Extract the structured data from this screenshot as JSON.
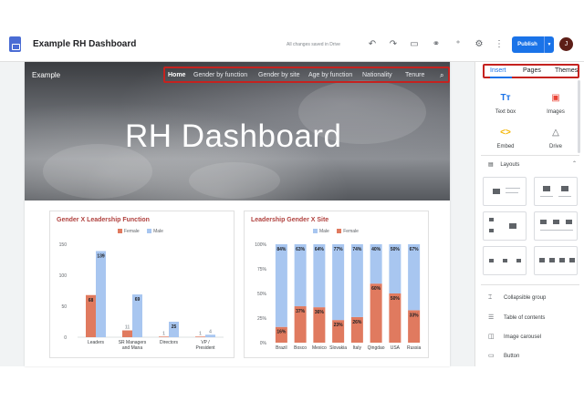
{
  "app": {
    "doc_title": "Example RH Dashboard",
    "save_status": "All changes saved in Drive",
    "publish_label": "Publish",
    "avatar_initial": "J"
  },
  "site": {
    "name": "Example",
    "nav": [
      "Home",
      "Gender by function",
      "Gender by site",
      "Age by function",
      "Nationality",
      "Tenure"
    ],
    "hero_title": "RH Dashboard"
  },
  "chart_data": [
    {
      "type": "bar",
      "title": "Gender X Leadership Function",
      "categories": [
        "Leaders",
        "SR Managers and Mana",
        "Directors",
        "VP / President"
      ],
      "series": [
        {
          "name": "Female",
          "values": [
            68,
            11,
            1,
            1
          ],
          "color": "#e07a5f"
        },
        {
          "name": "Male",
          "values": [
            139,
            69,
            25,
            4
          ],
          "color": "#a8c6f0"
        }
      ],
      "yticks": [
        "0",
        "50",
        "100",
        "150"
      ],
      "ylim": [
        0,
        150
      ],
      "legend": "top"
    },
    {
      "type": "bar",
      "stacked": true,
      "title": "Leadership Gender X Site",
      "categories": [
        "Brazil",
        "Bosco",
        "Mexico",
        "Slovakia",
        "Italy",
        "Qingdao",
        "USA",
        "Russia"
      ],
      "series": [
        {
          "name": "Female",
          "values": [
            16,
            37,
            36,
            23,
            26,
            60,
            50,
            33
          ],
          "labels": [
            "16%",
            "37%",
            "36%",
            "23%",
            "26%",
            "60%",
            "50%",
            "33%"
          ],
          "color": "#e07a5f"
        },
        {
          "name": "Male",
          "values": [
            84,
            63,
            64,
            77,
            74,
            40,
            50,
            67
          ],
          "labels": [
            "84%",
            "63%",
            "64%",
            "77%",
            "74%",
            "40%",
            "50%",
            "67%"
          ],
          "color": "#a8c6f0"
        }
      ],
      "yticks": [
        "0%",
        "25%",
        "50%",
        "75%",
        "100%"
      ],
      "ylim": [
        0,
        100
      ],
      "legend": "top"
    }
  ],
  "panel": {
    "tabs": [
      "Insert",
      "Pages",
      "Themes"
    ],
    "insert_items": [
      {
        "label": "Text box",
        "icon": "text-box-icon"
      },
      {
        "label": "Images",
        "icon": "image-icon"
      },
      {
        "label": "Embed",
        "icon": "embed-icon"
      },
      {
        "label": "Drive",
        "icon": "drive-icon"
      }
    ],
    "layouts_label": "Layouts",
    "list_items": [
      {
        "label": "Collapsible group",
        "icon": "collapsible-group-icon"
      },
      {
        "label": "Table of contents",
        "icon": "table-of-contents-icon"
      },
      {
        "label": "Image carousel",
        "icon": "image-carousel-icon"
      },
      {
        "label": "Button",
        "icon": "button-icon"
      }
    ]
  },
  "colors": {
    "accent": "#1a73e8",
    "highlight": "#c5221f",
    "female": "#e07a5f",
    "male": "#a8c6f0"
  }
}
